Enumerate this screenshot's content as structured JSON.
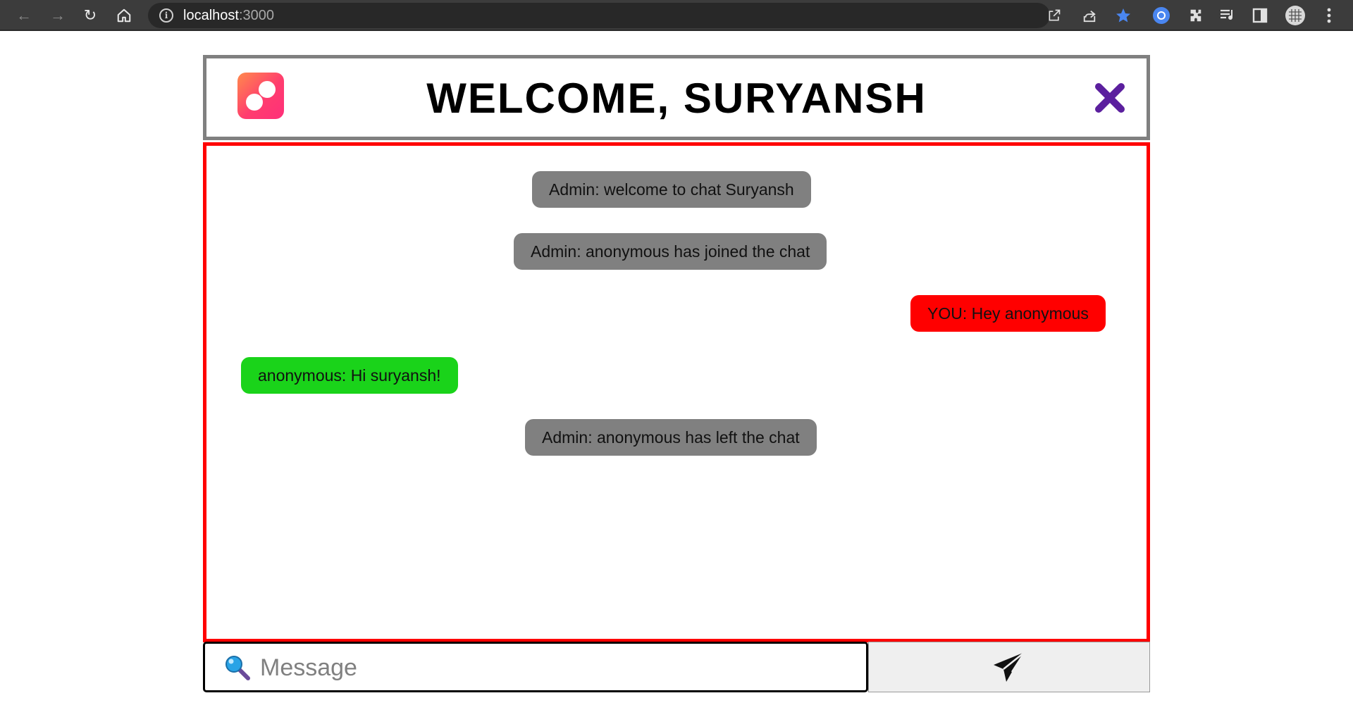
{
  "browser": {
    "url_host": "localhost",
    "url_port": ":3000",
    "icons": [
      "back-arrow-icon",
      "forward-arrow-icon",
      "reload-icon",
      "home-icon",
      "info-icon",
      "open-external-icon",
      "share-icon",
      "bookmark-star-icon",
      "extension-icon",
      "puzzle-icon",
      "media-queue-icon",
      "side-panel-icon",
      "profile-avatar",
      "menu-dots-icon"
    ],
    "accent_star": "#4a86f0"
  },
  "header": {
    "title": "WELCOME, SURYANSH",
    "close_icon_color": "#5b1f9e",
    "logo_gradient": [
      "#ff8a4c",
      "#ff2f7a"
    ]
  },
  "chat": {
    "border_color": "#ff0000",
    "messages": [
      {
        "sender": "admin",
        "text": "Admin: welcome to chat Suryansh",
        "color": "#808080"
      },
      {
        "sender": "admin",
        "text": "Admin: anonymous has joined the chat",
        "color": "#808080"
      },
      {
        "sender": "you",
        "text": "YOU: Hey anonymous",
        "color": "#ff0000"
      },
      {
        "sender": "other",
        "text": "anonymous: Hi suryansh!",
        "color": "#1ad31a"
      },
      {
        "sender": "admin",
        "text": "Admin: anonymous has left the chat",
        "color": "#808080"
      }
    ]
  },
  "composer": {
    "placeholder": "Message",
    "send_icon": "paper-plane-icon"
  }
}
